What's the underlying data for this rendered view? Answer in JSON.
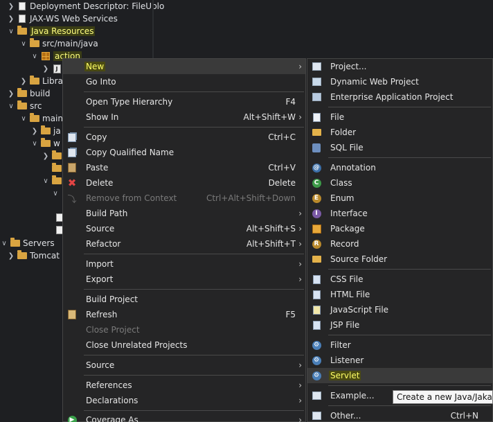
{
  "tree": {
    "items": [
      {
        "label": "Deployment Descriptor: FileUplo",
        "icon": "deployment-descriptor-icon"
      },
      {
        "label": "JAX-WS Web Services",
        "icon": "web-services-icon"
      },
      {
        "label": "Java Resources",
        "icon": "java-resources-icon"
      },
      {
        "label": "src/main/java",
        "icon": "source-folder-icon"
      },
      {
        "label": "action",
        "icon": "package-icon"
      },
      {
        "label": "J",
        "icon": "java-file-icon"
      },
      {
        "label": "Libra",
        "icon": "library-icon"
      },
      {
        "label": "build",
        "icon": "folder-icon"
      },
      {
        "label": "src",
        "icon": "folder-icon"
      },
      {
        "label": "main",
        "icon": "folder-icon"
      },
      {
        "label": "ja",
        "icon": "folder-icon"
      },
      {
        "label": "w",
        "icon": "folder-icon"
      },
      {
        "label": "Servers",
        "icon": "folder-icon"
      },
      {
        "label": "Tomcat",
        "icon": "folder-icon"
      }
    ]
  },
  "context_menu": {
    "items": [
      {
        "label": "New",
        "shortcut": "",
        "submenu": true
      },
      {
        "label": "Go Into",
        "shortcut": ""
      },
      {
        "label": "Open Type Hierarchy",
        "shortcut": "F4"
      },
      {
        "label": "Show In",
        "shortcut": "Alt+Shift+W",
        "submenu": true
      },
      {
        "label": "Copy",
        "shortcut": "Ctrl+C"
      },
      {
        "label": "Copy Qualified Name",
        "shortcut": ""
      },
      {
        "label": "Paste",
        "shortcut": "Ctrl+V"
      },
      {
        "label": "Delete",
        "shortcut": "Delete"
      },
      {
        "label": "Remove from Context",
        "shortcut": "Ctrl+Alt+Shift+Down",
        "disabled": true
      },
      {
        "label": "Build Path",
        "shortcut": "",
        "submenu": true
      },
      {
        "label": "Source",
        "shortcut": "Alt+Shift+S",
        "submenu": true
      },
      {
        "label": "Refactor",
        "shortcut": "Alt+Shift+T",
        "submenu": true
      },
      {
        "label": "Import",
        "shortcut": "",
        "submenu": true
      },
      {
        "label": "Export",
        "shortcut": "",
        "submenu": true
      },
      {
        "label": "Build Project",
        "shortcut": ""
      },
      {
        "label": "Refresh",
        "shortcut": "F5"
      },
      {
        "label": "Close Project",
        "shortcut": "",
        "disabled": true
      },
      {
        "label": "Close Unrelated Projects",
        "shortcut": ""
      },
      {
        "label": "Source",
        "shortcut": "",
        "submenu": true
      },
      {
        "label": "References",
        "shortcut": "",
        "submenu": true
      },
      {
        "label": "Declarations",
        "shortcut": "",
        "submenu": true
      },
      {
        "label": "Coverage As",
        "shortcut": "",
        "submenu": true
      }
    ]
  },
  "submenu_new": {
    "items": [
      {
        "label": "Project...",
        "shortcut": ""
      },
      {
        "label": "Dynamic Web Project",
        "shortcut": ""
      },
      {
        "label": "Enterprise Application Project",
        "shortcut": ""
      },
      {
        "label": "File",
        "shortcut": ""
      },
      {
        "label": "Folder",
        "shortcut": ""
      },
      {
        "label": "SQL File",
        "shortcut": ""
      },
      {
        "label": "Annotation",
        "shortcut": ""
      },
      {
        "label": "Class",
        "shortcut": ""
      },
      {
        "label": "Enum",
        "shortcut": ""
      },
      {
        "label": "Interface",
        "shortcut": ""
      },
      {
        "label": "Package",
        "shortcut": ""
      },
      {
        "label": "Record",
        "shortcut": ""
      },
      {
        "label": "Source Folder",
        "shortcut": ""
      },
      {
        "label": "CSS File",
        "shortcut": ""
      },
      {
        "label": "HTML File",
        "shortcut": ""
      },
      {
        "label": "JavaScript File",
        "shortcut": ""
      },
      {
        "label": "JSP File",
        "shortcut": ""
      },
      {
        "label": "Filter",
        "shortcut": ""
      },
      {
        "label": "Listener",
        "shortcut": ""
      },
      {
        "label": "Servlet",
        "shortcut": ""
      },
      {
        "label": "Example...",
        "shortcut": ""
      },
      {
        "label": "Other...",
        "shortcut": "Ctrl+N"
      }
    ]
  },
  "tooltip": {
    "text": "Create a new Java/Jakarta"
  },
  "colors": {
    "background": "#1e1f22",
    "menu_bg": "#252526",
    "highlight_text": "#ffff66",
    "highlight_bg": "#4a4a12"
  }
}
